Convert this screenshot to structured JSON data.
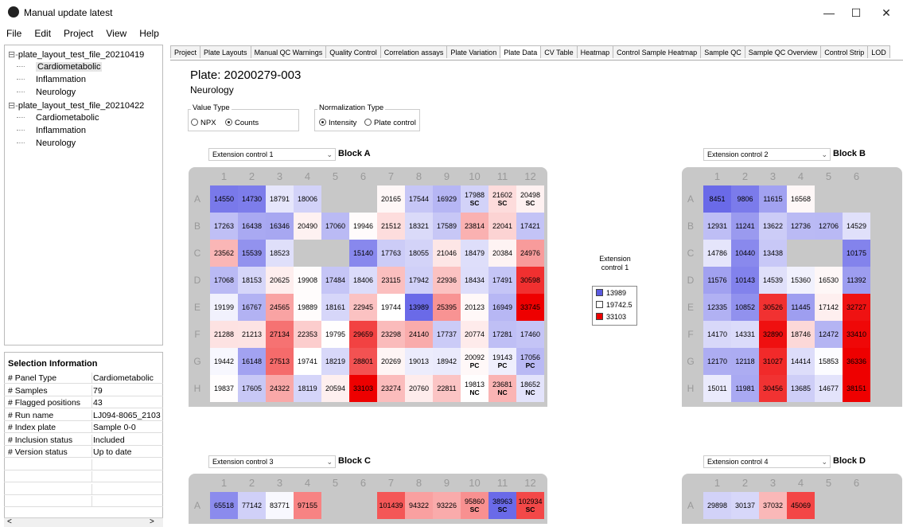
{
  "window": {
    "title": "Manual update latest",
    "controls": [
      "—",
      "☐",
      "✕"
    ]
  },
  "menu": [
    {
      "label": "File",
      "u": "F"
    },
    {
      "label": "Edit",
      "u": "E"
    },
    {
      "label": "Project",
      "u": "P"
    },
    {
      "label": "View",
      "u": "V"
    },
    {
      "label": "Help",
      "u": "H"
    }
  ],
  "tree": [
    {
      "label": "plate_layout_test_file_20210419",
      "level": 0,
      "prefix": "⊟-"
    },
    {
      "label": "Cardiometabolic",
      "level": 1,
      "selected": true
    },
    {
      "label": "Inflammation",
      "level": 1
    },
    {
      "label": "Neurology",
      "level": 1
    },
    {
      "label": "plate_layout_test_file_20210422",
      "level": 0,
      "prefix": "⊟-"
    },
    {
      "label": "Cardiometabolic",
      "level": 1
    },
    {
      "label": "Inflammation",
      "level": 1
    },
    {
      "label": "Neurology",
      "level": 1
    }
  ],
  "selection_info": {
    "title": "Selection Information",
    "rows": [
      {
        "k": "# Panel Type",
        "v": "Cardiometabolic"
      },
      {
        "k": "# Samples",
        "v": "79"
      },
      {
        "k": "# Flagged positions",
        "v": "43"
      },
      {
        "k": "# Run name",
        "v": "LJ094-8065_2103.."
      },
      {
        "k": "# Index plate",
        "v": "Sample 0-0"
      },
      {
        "k": "# Inclusion status",
        "v": "Included"
      },
      {
        "k": "# Version status",
        "v": "Up to date"
      },
      {
        "k": "",
        "v": ""
      },
      {
        "k": "",
        "v": ""
      },
      {
        "k": "",
        "v": ""
      },
      {
        "k": "",
        "v": ""
      }
    ],
    "scroll_left": "<",
    "scroll_right": ">"
  },
  "tabs": [
    "Project",
    "Plate Layouts",
    "Manual QC Warnings",
    "Quality Control",
    "Correlation assays",
    "Plate Variation",
    "Plate Data",
    "CV Table",
    "Heatmap",
    "Control Sample Heatmap",
    "Sample QC",
    "Sample QC Overview",
    "Control Strip",
    "LOD"
  ],
  "active_tab": "Plate Data",
  "plate": {
    "title": "Plate: 20200279-003",
    "panel": "Neurology",
    "value_type": {
      "label": "Value Type",
      "options": [
        "NPX",
        "Counts"
      ],
      "selected": "Counts"
    },
    "normalization": {
      "label": "Normalization Type",
      "options": [
        "Intensity",
        "Plate control"
      ],
      "selected": "Intensity"
    }
  },
  "legend": {
    "title": "Extension control 1",
    "entries": [
      {
        "label": "13989",
        "color": "#5a5ae0"
      },
      {
        "label": "19742.5",
        "color": "#ffffff"
      },
      {
        "label": "33103",
        "color": "#ee0000"
      }
    ]
  },
  "col_labels": [
    "1",
    "2",
    "3",
    "4",
    "5",
    "6",
    "7",
    "8",
    "9",
    "10",
    "11",
    "12"
  ],
  "row_labels": [
    "A",
    "B",
    "C",
    "D",
    "E",
    "F",
    "G",
    "H"
  ],
  "blocks": [
    {
      "dropdown": "Extension control 1",
      "label": "Block A",
      "rows": [
        [
          "14550",
          "14730",
          "18791",
          "18006",
          "",
          "",
          "20165",
          "17544",
          "16929",
          "17988|SC",
          "21602|SC",
          "20498|SC"
        ],
        [
          "17263",
          "16438",
          "16346",
          "20490",
          "17060",
          "19946",
          "21512",
          "18321",
          "17589",
          "23814",
          "22041",
          "17421"
        ],
        [
          "23562",
          "15539",
          "18523",
          "",
          "",
          "15140",
          "17763",
          "18055",
          "21046",
          "18479",
          "20384",
          "24976"
        ],
        [
          "17068",
          "18153",
          "20625",
          "19908",
          "17484",
          "18406",
          "23115",
          "17942",
          "22936",
          "18434",
          "17491",
          "30598"
        ],
        [
          "19199",
          "16767",
          "24565",
          "19889",
          "18161",
          "22945",
          "19744",
          "13989",
          "25395",
          "20123",
          "16949",
          "33745"
        ],
        [
          "21288",
          "21213",
          "27134",
          "22353",
          "19795",
          "29659",
          "23298",
          "24140",
          "17737",
          "20774",
          "17281",
          "17460"
        ],
        [
          "19442",
          "16148",
          "27513",
          "19741",
          "18219",
          "28801",
          "20269",
          "19013",
          "18942",
          "20092|PC",
          "19143|PC",
          "17056|PC"
        ],
        [
          "19837",
          "17605",
          "24322",
          "18119",
          "20594",
          "33103",
          "23274",
          "20760",
          "22811",
          "19813|NC",
          "23681|NC",
          "18652|NC"
        ]
      ]
    },
    {
      "dropdown": "Extension control 2",
      "label": "Block B",
      "rows": [
        [
          "8451",
          "9806",
          "11615",
          "16568",
          "",
          ""
        ],
        [
          "12931",
          "11241",
          "13622",
          "12736",
          "12706",
          "14529"
        ],
        [
          "14786",
          "10440",
          "13438",
          "",
          "",
          "10175"
        ],
        [
          "11576",
          "10143",
          "14539",
          "15360",
          "16530",
          "11392"
        ],
        [
          "12335",
          "10852",
          "30526",
          "11445",
          "17142",
          "32727"
        ],
        [
          "14170",
          "14331",
          "32890",
          "18746",
          "12472",
          "33410"
        ],
        [
          "12170",
          "12118",
          "31027",
          "14414",
          "15853",
          "36336"
        ],
        [
          "15011",
          "11981",
          "30456",
          "13685",
          "14677",
          "38151"
        ]
      ]
    },
    {
      "dropdown": "Extension control 3",
      "label": "Block C",
      "rows": [
        [
          "65518",
          "77142",
          "83771",
          "97155",
          "",
          "",
          "101439",
          "94322",
          "93226",
          "95860|SC",
          "38963|SC",
          "102934|SC"
        ]
      ]
    },
    {
      "dropdown": "Extension control 4",
      "label": "Block D",
      "rows": [
        [
          "29898",
          "30137",
          "37032",
          "45069",
          "",
          ""
        ]
      ]
    }
  ]
}
